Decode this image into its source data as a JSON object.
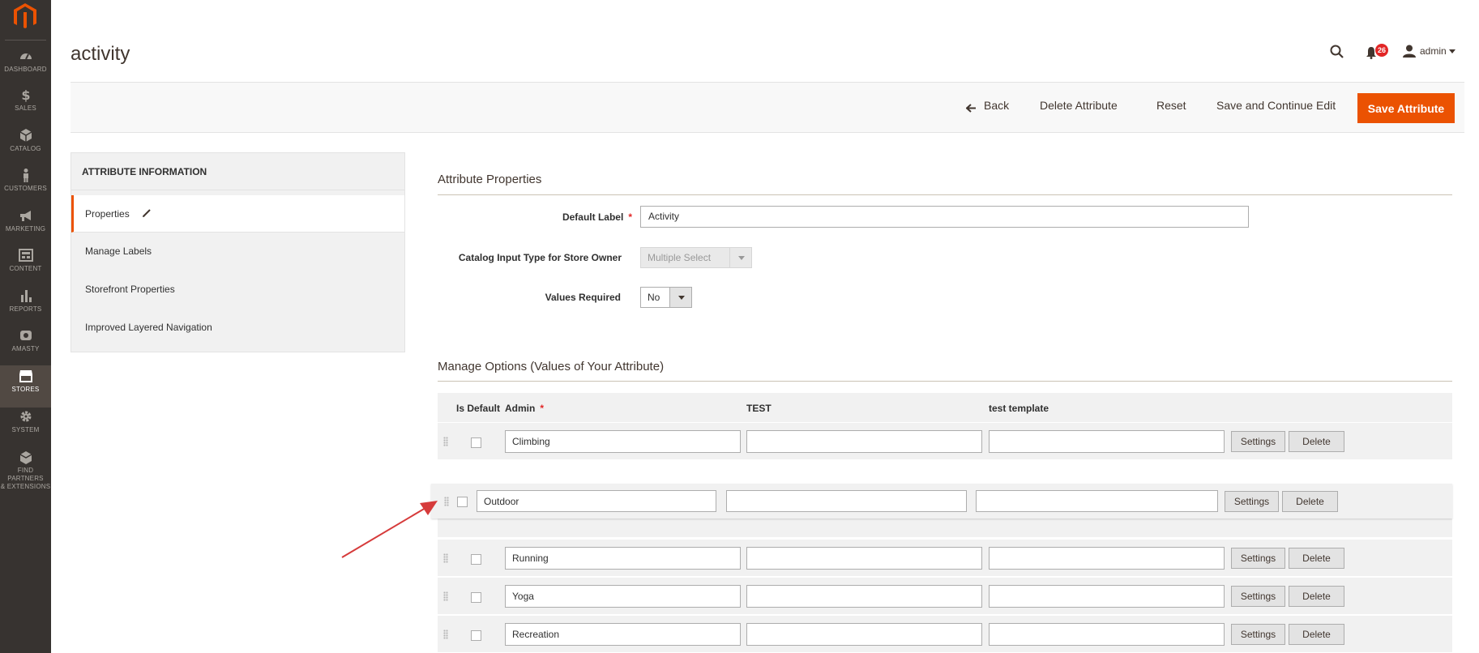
{
  "sidebar": {
    "items": [
      {
        "label": "DASHBOARD",
        "icon": "dashboard-icon"
      },
      {
        "label": "SALES",
        "icon": "dollar-icon"
      },
      {
        "label": "CATALOG",
        "icon": "catalog-box-icon"
      },
      {
        "label": "CUSTOMERS",
        "icon": "customer-person-icon"
      },
      {
        "label": "MARKETING",
        "icon": "megaphone-icon"
      },
      {
        "label": "CONTENT",
        "icon": "content-layout-icon"
      },
      {
        "label": "REPORTS",
        "icon": "bar-chart-icon"
      },
      {
        "label": "AMASTY",
        "icon": "amasty-logo-icon"
      },
      {
        "label": "STORES",
        "icon": "store-icon"
      },
      {
        "label": "SYSTEM",
        "icon": "gear-icon"
      },
      {
        "label1": "FIND PARTNERS",
        "label2": "& EXTENSIONS",
        "icon": "partners-box-icon"
      }
    ]
  },
  "header": {
    "title": "activity",
    "notifications_count": "26",
    "user": "admin"
  },
  "actions": {
    "back": "Back",
    "delete": "Delete Attribute",
    "reset": "Reset",
    "save_continue": "Save and Continue Edit",
    "save": "Save Attribute"
  },
  "tabs": {
    "header": "ATTRIBUTE INFORMATION",
    "items": [
      "Properties",
      "Manage Labels",
      "Storefront Properties",
      "Improved Layered Navigation"
    ]
  },
  "properties": {
    "title": "Attribute Properties",
    "default_label": {
      "label": "Default Label",
      "value": "Activity"
    },
    "input_type": {
      "label": "Catalog Input Type for Store Owner",
      "value": "Multiple Select"
    },
    "values_required": {
      "label": "Values Required",
      "value": "No"
    }
  },
  "options": {
    "title": "Manage Options (Values of Your Attribute)",
    "columns": {
      "is_default": "Is Default",
      "admin": "Admin",
      "test": "TEST",
      "test_template": "test template"
    },
    "rows": [
      "Climbing",
      "Running",
      "Yoga",
      "Recreation"
    ],
    "dragging_row": "Outdoor",
    "settings_label": "Settings",
    "delete_label": "Delete"
  },
  "colors": {
    "accent": "#eb5202",
    "sidebar": "#373330",
    "badge": "#e22626"
  }
}
